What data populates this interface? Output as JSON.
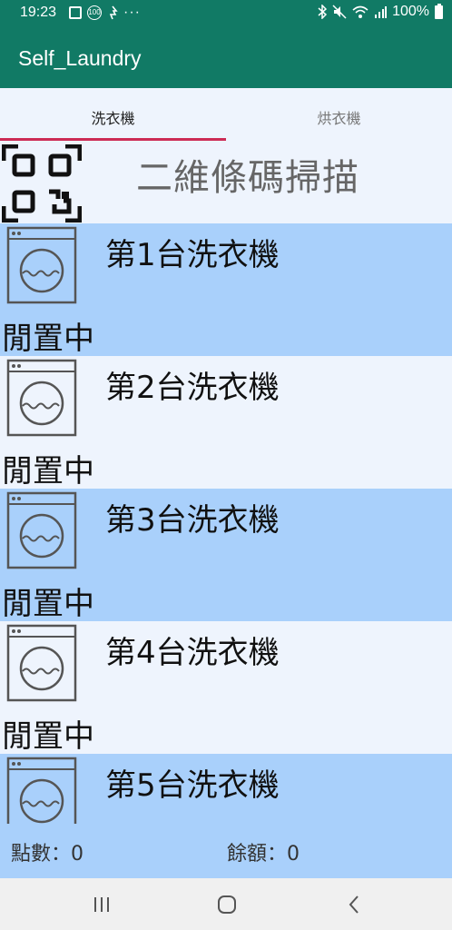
{
  "status_bar": {
    "time": "19:23",
    "badge": "100",
    "more": "···",
    "battery": "100%"
  },
  "app": {
    "title": "Self_Laundry"
  },
  "tabs": [
    {
      "label": "洗衣機",
      "selected": true
    },
    {
      "label": "烘衣機",
      "selected": false
    }
  ],
  "scan": {
    "label": "二維條碼掃描",
    "icon": "qr-code-icon"
  },
  "machines": [
    {
      "name": "第1台洗衣機",
      "status": "閒置中",
      "icon": "washing-machine-icon"
    },
    {
      "name": "第2台洗衣機",
      "status": "閒置中",
      "icon": "washing-machine-icon"
    },
    {
      "name": "第3台洗衣機",
      "status": "閒置中",
      "icon": "washing-machine-icon"
    },
    {
      "name": "第4台洗衣機",
      "status": "閒置中",
      "icon": "washing-machine-icon"
    },
    {
      "name": "第5台洗衣機",
      "icon": "washing-machine-icon"
    }
  ],
  "footer": {
    "points": "點數：0",
    "balance": "餘額：0"
  },
  "colors": {
    "app_bar": "#117a65",
    "accent": "#cc2b55",
    "row_blue": "#a9d0fb",
    "row_light": "#eef4fd"
  }
}
